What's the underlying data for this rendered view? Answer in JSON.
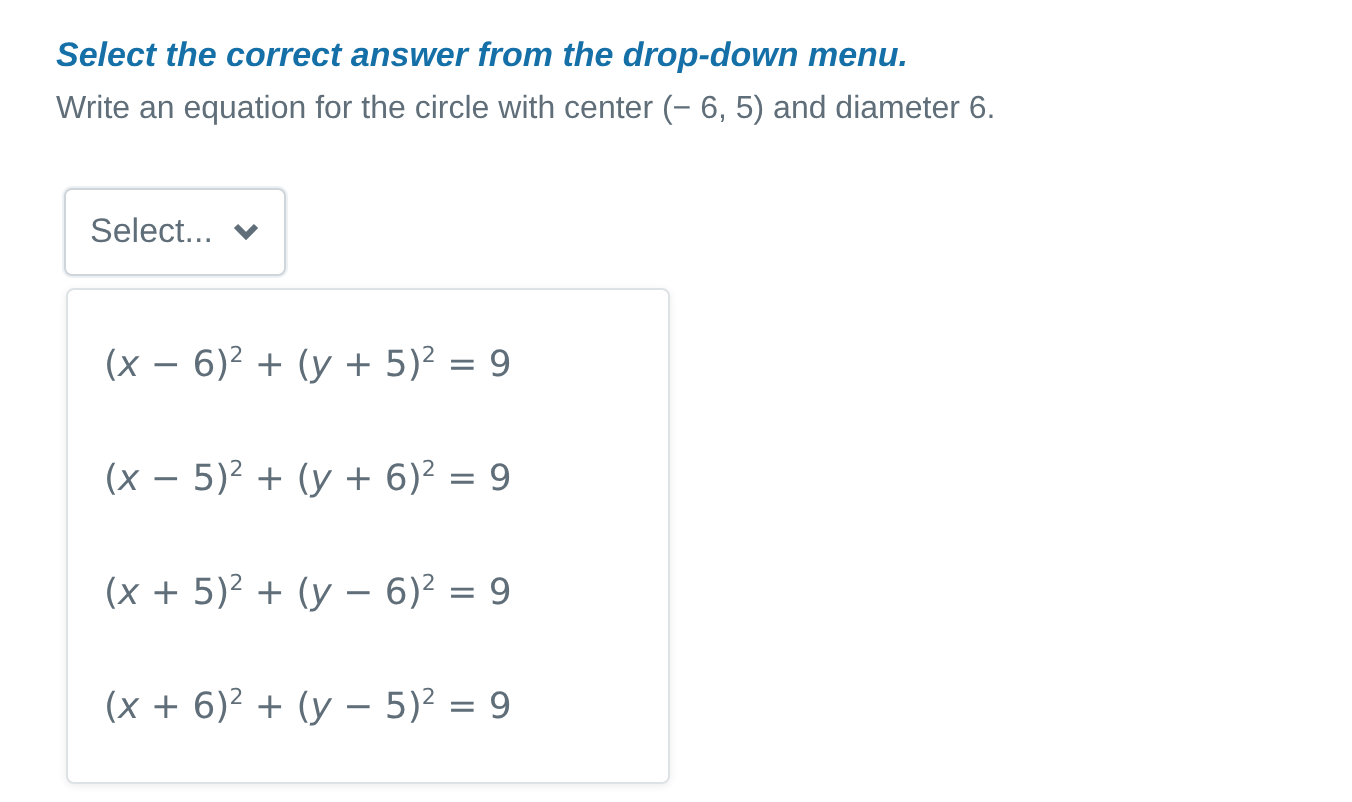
{
  "instruction": "Select the correct answer from the drop-down menu.",
  "question": "Write an equation for the circle with center (− 6,  5) and diameter 6.",
  "dropdown": {
    "placeholder": "Select...",
    "expanded": true,
    "options": [
      {
        "label": "(*x* − 6)$^{2}$ + (*y* + 5)$^{2}$ = 9"
      },
      {
        "label": "(*x* − 5)$^{2}$ + (*y* + 6)$^{2}$ = 9"
      },
      {
        "label": "(*x* + 5)$^{2}$ + (*y* − 6)$^{2}$ = 9"
      },
      {
        "label": "(*x* + 6)$^{2}$ + (*y* − 5)$^{2}$ = 9"
      }
    ]
  }
}
